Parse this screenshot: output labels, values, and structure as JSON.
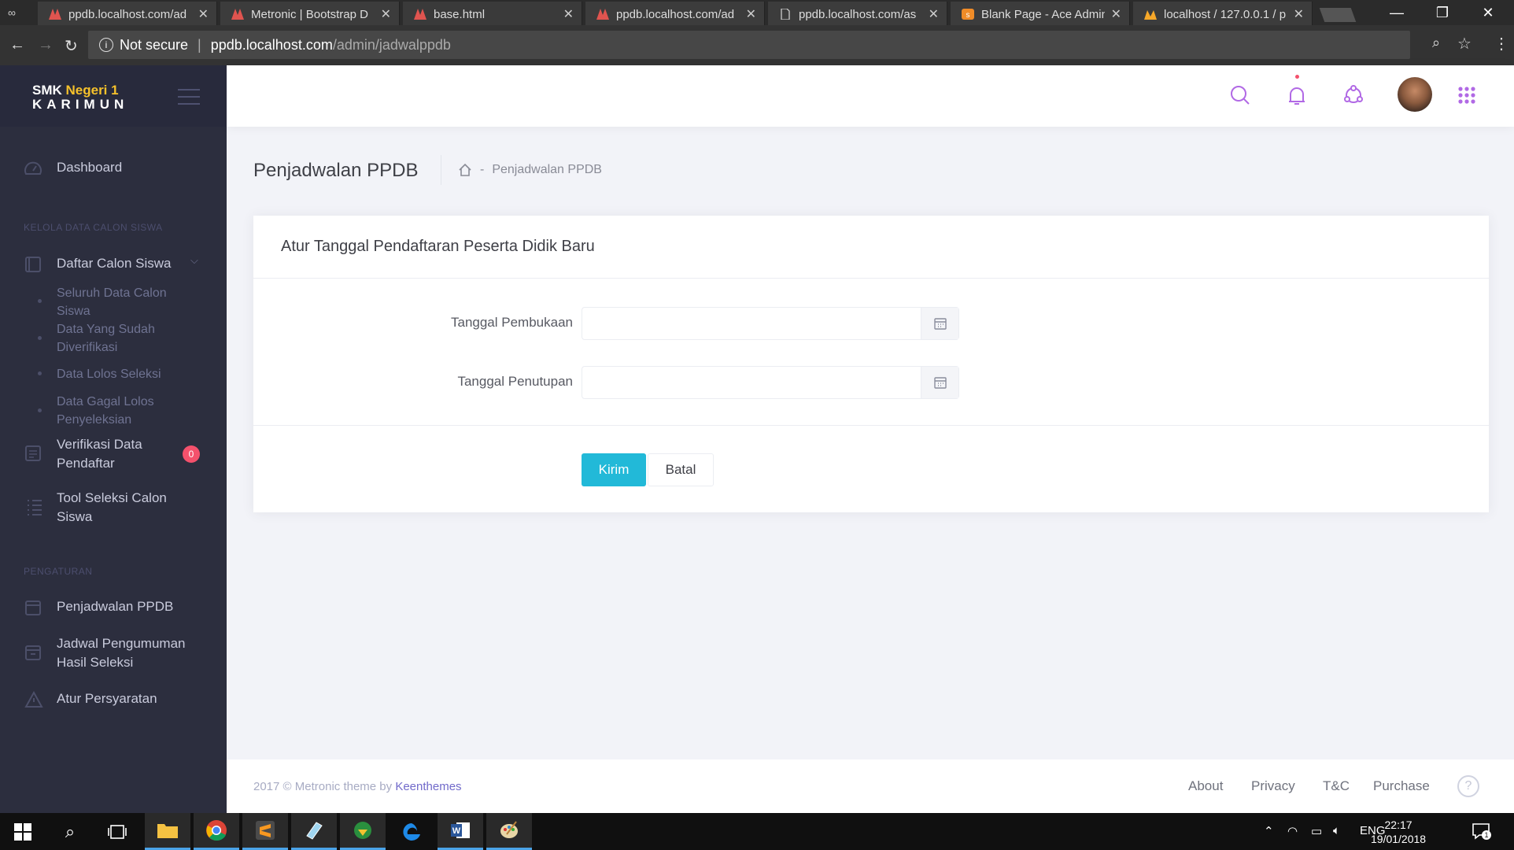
{
  "browser": {
    "tabs": [
      {
        "title": "ppdb.localhost.com/ad",
        "favicon": "metronic-icon"
      },
      {
        "title": "Metronic | Bootstrap D",
        "favicon": "metronic-icon"
      },
      {
        "title": "base.html",
        "favicon": "metronic-icon"
      },
      {
        "title": "ppdb.localhost.com/ad",
        "favicon": "metronic-icon"
      },
      {
        "title": "ppdb.localhost.com/as",
        "favicon": "document-icon"
      },
      {
        "title": "Blank Page - Ace Admin",
        "favicon": "xampp-icon"
      },
      {
        "title": "localhost / 127.0.0.1 / p",
        "favicon": "phpmyadmin-icon"
      }
    ],
    "security": "Not secure",
    "url_host": "ppdb.localhost.com",
    "url_path": "/admin/jadwalppdb"
  },
  "brand": {
    "line1a": "SMK ",
    "line1b": "Negeri 1",
    "line2": "KARIMUN"
  },
  "sidebar": {
    "dashboard": "Dashboard",
    "section1": "KELOLA DATA CALON SISWA",
    "daftar": "Daftar Calon Siswa",
    "sub1": "Seluruh Data Calon Siswa",
    "sub2": "Data Yang Sudah Diverifikasi",
    "sub3": "Data Lolos Seleksi",
    "sub4": "Data Gagal Lolos Penyeleksian",
    "verifikasi": "Verifikasi Data Pendaftar",
    "verifikasi_badge": "0",
    "tool": "Tool Seleksi Calon Siswa",
    "section2": "PENGATURAN",
    "penjadwalan": "Penjadwalan PPDB",
    "jadwal": "Jadwal Pengumuman Hasil Seleksi",
    "syarat": "Atur Persyaratan"
  },
  "page": {
    "title": "Penjadwalan PPDB",
    "breadcrumb_sep": "-",
    "breadcrumb": "Penjadwalan PPDB",
    "form_title": "Atur Tanggal Pendaftaran Peserta Didik Baru",
    "label_open": "Tanggal Pembukaan",
    "label_close": "Tanggal Penutupan",
    "value_open": "",
    "value_close": "",
    "btn_send": "Kirim",
    "btn_cancel": "Batal"
  },
  "footer": {
    "copy": "2017 © Metronic theme by ",
    "copy_link": "Keenthemes",
    "about": "About",
    "privacy": "Privacy",
    "tc": "T&C",
    "purchase": "Purchase",
    "help": "?"
  },
  "taskbar": {
    "lang": "ENG",
    "time": "22:17",
    "date": "19/01/2018",
    "notif_count": "1"
  },
  "colors": {
    "accent": "#22b9d8",
    "sidebar": "#2c2e3e",
    "icon_purple": "#b169e5",
    "badge": "#f4516c"
  }
}
